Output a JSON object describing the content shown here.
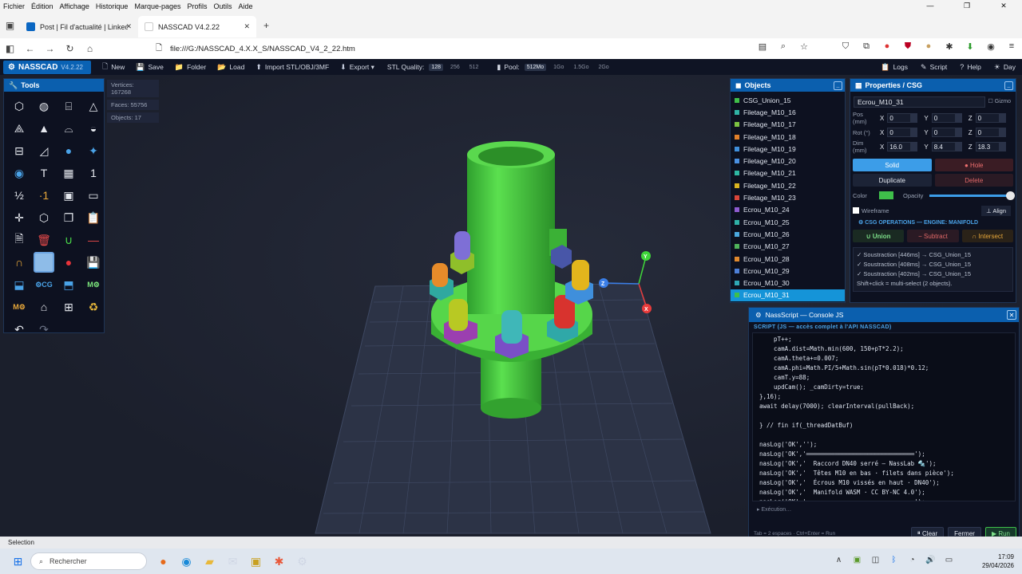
{
  "os_menu": [
    "Fichier",
    "Édition",
    "Affichage",
    "Historique",
    "Marque-pages",
    "Profils",
    "Outils",
    "Aide"
  ],
  "browser": {
    "tabs": [
      {
        "label": "Post | Fil d'actualité | LinkedIn",
        "active": false,
        "color": "#0a66c2"
      },
      {
        "label": "NASSCAD V4.2.22",
        "active": true,
        "color": "#ffffff"
      }
    ],
    "url": "file:///G:/NASSCAD_4.X.X_S/NASSCAD_V4_2_22.htm"
  },
  "app": {
    "name": "NASSCAD",
    "version": "V4.2.22",
    "toolbar": [
      "New",
      "Save",
      "Folder",
      "Load",
      "Import STL/OBJ/3MF",
      "Export ▾"
    ],
    "stl_quality_label": "STL Quality:",
    "stl_quality": [
      "128",
      "256",
      "512"
    ],
    "pool_label": "Pool:",
    "pool": [
      "512Mo",
      "1Go",
      "1.5Go",
      "2Go"
    ],
    "right": [
      "Logs",
      "Script",
      "Help",
      "Day"
    ]
  },
  "stats": {
    "vertices": "Vertices: 167268",
    "faces": "Faces: 55756",
    "objects": "Objects: 17"
  },
  "tools": {
    "title": "Tools"
  },
  "objects": {
    "title": "Objects",
    "items": [
      {
        "name": "CSG_Union_15",
        "color": "#3fbf4a"
      },
      {
        "name": "Filetage_M10_16",
        "color": "#2fb3a6"
      },
      {
        "name": "Filetage_M10_17",
        "color": "#7cc242"
      },
      {
        "name": "Filetage_M10_18",
        "color": "#e07f2a"
      },
      {
        "name": "Filetage_M10_19",
        "color": "#3f8fdc"
      },
      {
        "name": "Filetage_M10_20",
        "color": "#4a90e2"
      },
      {
        "name": "Filetage_M10_21",
        "color": "#2db7a3"
      },
      {
        "name": "Filetage_M10_22",
        "color": "#d9b420"
      },
      {
        "name": "Filetage_M10_23",
        "color": "#d8453a"
      },
      {
        "name": "Ecrou_M10_24",
        "color": "#8e5bd0"
      },
      {
        "name": "Ecrou_M10_25",
        "color": "#2fb0a8"
      },
      {
        "name": "Ecrou_M10_26",
        "color": "#4aa8e0"
      },
      {
        "name": "Ecrou_M10_27",
        "color": "#4fb35b"
      },
      {
        "name": "Ecrou_M10_28",
        "color": "#e0892e"
      },
      {
        "name": "Ecrou_M10_29",
        "color": "#4d7fd8"
      },
      {
        "name": "Ecrou_M10_30",
        "color": "#2fa7b5"
      },
      {
        "name": "Ecrou_M10_31",
        "color": "#3fbf4a",
        "selected": true
      }
    ]
  },
  "props": {
    "title": "Properties / CSG",
    "name": "Ecrou_M10_31",
    "gizmo": "Gizmo",
    "pos_label": "Pos (mm)",
    "pos": [
      "0",
      "0",
      "0"
    ],
    "rot_label": "Rot (°)",
    "rot": [
      "0",
      "0",
      "0"
    ],
    "dim_label": "Dim (mm)",
    "dim": [
      "16.0",
      "8.4",
      "18.3"
    ],
    "solid": "Solid",
    "hole": "Hole",
    "duplicate": "Duplicate",
    "delete": "Delete",
    "color_label": "Color",
    "color_value": "#3fbf4a",
    "opacity_label": "Opacity",
    "opacity_value": 1.0,
    "wireframe": "Wireframe",
    "align": "Align",
    "csg_title": "⚙ CSG OPERATIONS — ENGINE: MANIFOLD",
    "union": "∪ Union",
    "subtract": "− Subtract",
    "intersect": "∩ Intersect",
    "log": [
      "✓ Soustraction [446ms] → CSG_Union_15",
      "✓ Soustraction [408ms] → CSG_Union_15",
      "✓ Soustraction [402ms] → CSG_Union_15",
      "Shift+click = multi-select (2 objects)."
    ]
  },
  "console": {
    "title": "NassScript — Console JS",
    "subtitle": "SCRIPT (JS — accès complet à l'API NASSCAD)",
    "code": "    pT++;\n    camA.dist=Math.min(600, 150+pT*2.2);\n    camA.theta+=0.007;\n    camA.phi=Math.PI/5+Math.sin(pT*0.018)*0.12;\n    camT.y=88;\n    updCam(); _camDirty=true;\n},16);\nawait delay(7000); clearInterval(pullBack);\n\n} // fin if(_threadDatBuf)\n\nnasLog('OK','');\nnasLog('OK','══════════════════════════════');\nnasLog('OK','  Raccord DN40 serré — NassLab 🔩');\nnasLog('OK','  Têtes M10 en bas · filets dans pièce');\nnasLog('OK','  Écrous M10 vissés en haut · DN40');\nnasLog('OK','  Manifold WASM · CC BY-NC 4.0');\nnasLog('OK','══════════════════════════════');",
    "exec": "▸ Exécution…",
    "hint": "Tab = 2 espaces · Ctrl+Enter = Run",
    "clear": "Clear",
    "close": "Fermer",
    "run": "▶ Run"
  },
  "status": "Selection",
  "taskbar": {
    "search": "Rechercher",
    "time": "17:09",
    "date": "29/04/2026"
  }
}
